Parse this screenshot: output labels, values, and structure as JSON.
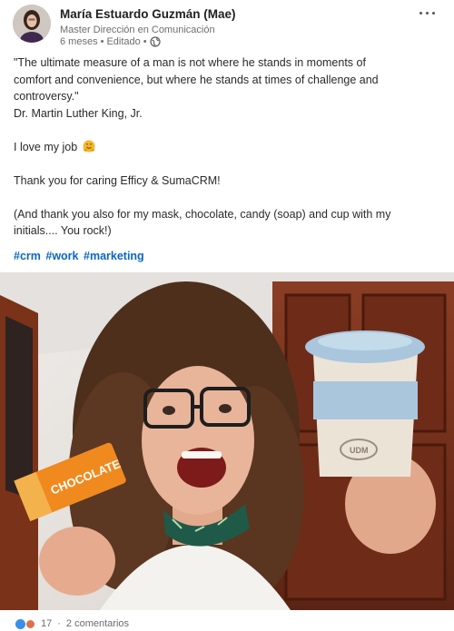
{
  "author": {
    "name": "María Estuardo Guzmán (Mae)",
    "title": "Master Dirección en Comunicación",
    "time": "6 meses",
    "separator": "•",
    "edited": "Editado",
    "visibility_icon": "globe-icon"
  },
  "menu": {
    "icon": "more-options-icon"
  },
  "post": {
    "quote_line1": "\"The ultimate measure of a man is not where he stands in moments of",
    "quote_line2": "comfort and convenience, but where he stands at times of challenge and",
    "quote_line3": "controversy.\"",
    "attribution": "Dr. Martin Luther King, Jr.",
    "love_job": "I love my job",
    "love_job_emoji": "hugging-face-emoji",
    "thanks": "Thank you for caring Efficy & SumaCRM!",
    "extra_line1": "(And thank you also for my mask, chocolate, candy (soap) and cup with my",
    "extra_line2": "initials.... You rock!)",
    "hashtags": [
      "#crm",
      "#work",
      "#marketing"
    ]
  },
  "photo": {
    "cup_text": "UDM",
    "chocolate_text": "CHOCOLATE"
  },
  "social": {
    "reactions": [
      "like-icon",
      "love-icon"
    ],
    "count": "17",
    "separator": "·",
    "comments": "2 comentarios"
  },
  "colors": {
    "link": "#0a66c2",
    "muted": "#6d6d6d",
    "like": "#378fe9",
    "love": "#df704d"
  }
}
